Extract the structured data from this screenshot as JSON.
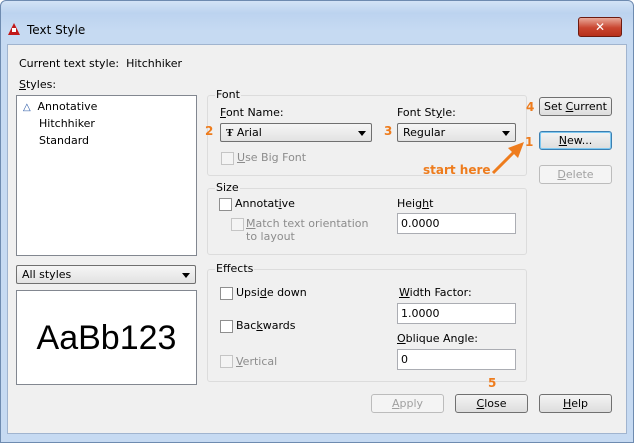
{
  "window": {
    "title": "Text Style",
    "close_glyph": "✕"
  },
  "current_style": {
    "label": "Current text style:",
    "value": "Hitchhiker"
  },
  "styles": {
    "label": "Styles:",
    "items": [
      {
        "label": "Annotative",
        "icon": "annotative-icon"
      },
      {
        "label": "Hitchhiker",
        "selected": true
      },
      {
        "label": "Standard"
      }
    ],
    "filter_value": "All styles"
  },
  "preview": {
    "text": "AaBb123"
  },
  "font": {
    "group_label": "Font",
    "font_name_label": "Font Name:",
    "font_name_value": "Arial",
    "font_name_icon": "truetype-icon",
    "font_style_label": "Font Style:",
    "font_style_value": "Regular",
    "use_big_font_label": "Use Big Font"
  },
  "size": {
    "group_label": "Size",
    "annotative_label": "Annotative",
    "match_orientation_label_1": "Match text orientation",
    "match_orientation_label_2": "to layout",
    "height_label": "Height",
    "height_value": "0.0000"
  },
  "effects": {
    "group_label": "Effects",
    "upside_down_label": "Upside down",
    "backwards_label": "Backwards",
    "vertical_label": "Vertical",
    "width_factor_label": "Width Factor:",
    "width_factor_value": "1.0000",
    "oblique_angle_label": "Oblique Angle:",
    "oblique_angle_value": "0"
  },
  "buttons": {
    "set_current": "Set Current",
    "new": "New...",
    "delete": "Delete",
    "apply": "Apply",
    "close": "Close",
    "help": "Help"
  },
  "annotations": {
    "step_1": "1",
    "step_2": "2",
    "step_3": "3",
    "step_4": "4",
    "step_5": "5",
    "start_here": "start here",
    "color": "#ee7c1d"
  }
}
